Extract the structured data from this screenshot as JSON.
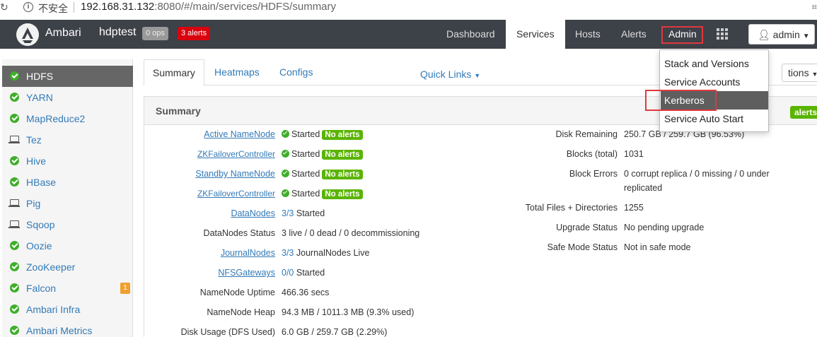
{
  "browser": {
    "insecure_label": "不安全",
    "url_host": "192.168.31.132",
    "url_rest": ":8080/#/main/services/HDFS/summary"
  },
  "topnav": {
    "brand": "Ambari",
    "cluster": "hdptest",
    "ops_badge": "0 ops",
    "alerts_badge": "3 alerts",
    "links": [
      "Dashboard",
      "Services",
      "Hosts",
      "Alerts",
      "Admin"
    ],
    "active_link": "Services",
    "user_label": "admin"
  },
  "admin_menu": {
    "items": [
      "Stack and Versions",
      "Service Accounts",
      "Kerberos",
      "Service Auto Start"
    ],
    "highlighted": "Kerberos"
  },
  "sidebar": {
    "items": [
      {
        "label": "HDFS",
        "icon": "check-icon",
        "active": true
      },
      {
        "label": "YARN",
        "icon": "check-icon"
      },
      {
        "label": "MapReduce2",
        "icon": "check-icon"
      },
      {
        "label": "Tez",
        "icon": "laptop-icon"
      },
      {
        "label": "Hive",
        "icon": "check-icon"
      },
      {
        "label": "HBase",
        "icon": "check-icon"
      },
      {
        "label": "Pig",
        "icon": "laptop-icon"
      },
      {
        "label": "Sqoop",
        "icon": "laptop-icon"
      },
      {
        "label": "Oozie",
        "icon": "check-icon"
      },
      {
        "label": "ZooKeeper",
        "icon": "check-icon"
      },
      {
        "label": "Falcon",
        "icon": "check-icon",
        "badge": "1"
      },
      {
        "label": "Ambari Infra",
        "icon": "check-icon"
      },
      {
        "label": "Ambari Metrics",
        "icon": "check-icon"
      }
    ]
  },
  "tabs": [
    "Summary",
    "Heatmaps",
    "Configs"
  ],
  "quick_links": "Quick Links",
  "actions_label": "tions",
  "summary": {
    "title": "Summary",
    "alerts_pill": "alerts",
    "started": "Started",
    "no_alerts": "No alerts",
    "left_rows": [
      {
        "label": "Active NameNode"
      },
      {
        "label": "ZKFailoverController"
      },
      {
        "label": "Standby NameNode"
      },
      {
        "label": "ZKFailoverController"
      },
      {
        "label": "DataNodes",
        "value_link": "3/3",
        "value": " Started"
      },
      {
        "label": "DataNodes Status",
        "value": "3 live / 0 dead / 0 decommissioning"
      },
      {
        "label": "JournalNodes",
        "value_link": "3/3",
        "value": " JournalNodes Live"
      },
      {
        "label": "NFSGateways",
        "value_link": "0/0",
        "value": " Started"
      },
      {
        "label": "NameNode Uptime",
        "value": "466.36 secs"
      },
      {
        "label": "NameNode Heap",
        "value": "94.3 MB / 1011.3 MB (9.3% used)"
      },
      {
        "label": "Disk Usage (DFS Used)",
        "value": "6.0 GB / 259.7 GB (2.29%)"
      }
    ],
    "right_rows": [
      {
        "label": "Disk Remaining",
        "value": "250.7 GB / 259.7 GB (96.53%)"
      },
      {
        "label": "Blocks (total)",
        "value": "1031"
      },
      {
        "label": "Block Errors",
        "value": "0 corrupt replica / 0 missing / 0 under replicated"
      },
      {
        "label": "Total Files + Directories",
        "value": "1255"
      },
      {
        "label": "Upgrade Status",
        "value": "No pending upgrade"
      },
      {
        "label": "Safe Mode Status",
        "value": "Not in safe mode"
      }
    ]
  }
}
